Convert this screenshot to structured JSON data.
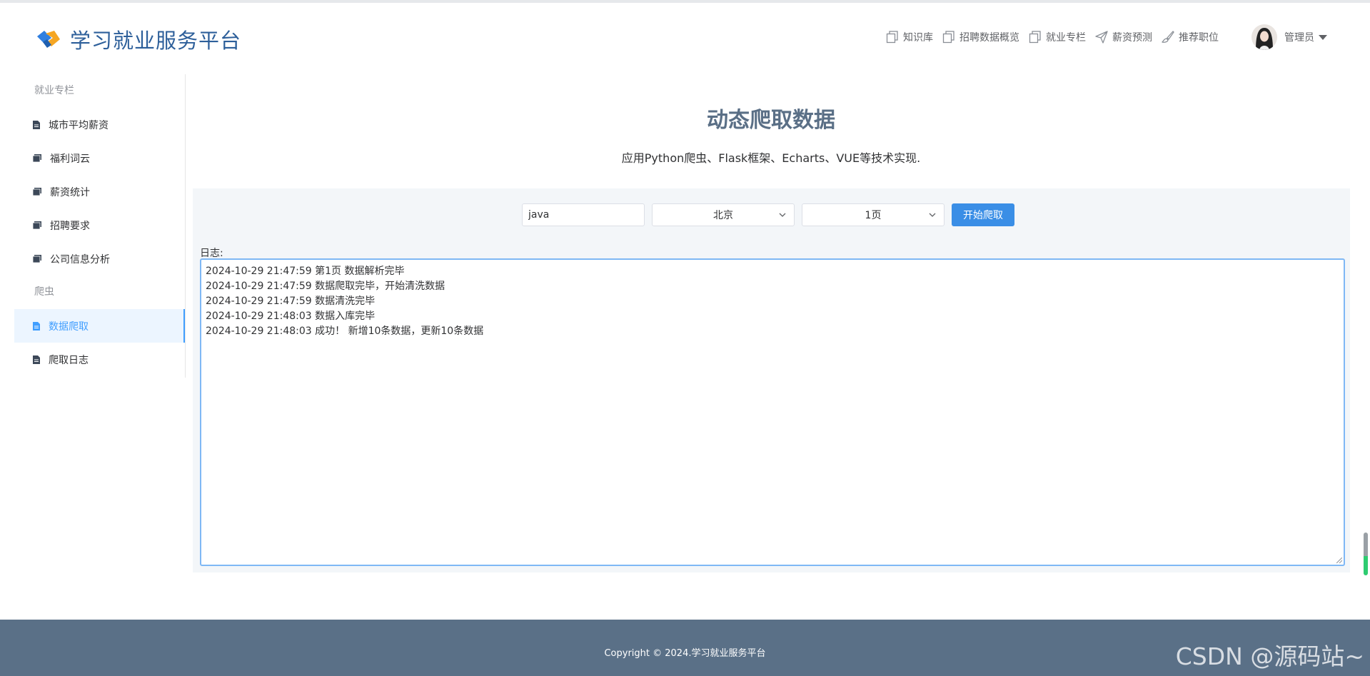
{
  "header": {
    "app_title": "学习就业服务平台",
    "nav": [
      {
        "label": "知识库",
        "icon": "copy-icon"
      },
      {
        "label": "招聘数据概览",
        "icon": "copy-icon"
      },
      {
        "label": "就业专栏",
        "icon": "copy-icon"
      },
      {
        "label": "薪资预测",
        "icon": "send-icon"
      },
      {
        "label": "推荐职位",
        "icon": "brush-icon"
      }
    ],
    "user_name": "管理员"
  },
  "sidebar": {
    "group1": "就业专栏",
    "items1": [
      "城市平均薪资",
      "福利词云",
      "薪资统计",
      "招聘要求",
      "公司信息分析"
    ],
    "group2": "爬虫",
    "items2": [
      "数据爬取",
      "爬取日志"
    ],
    "active": "数据爬取"
  },
  "main": {
    "title": "动态爬取数据",
    "subtitle": "应用Python爬虫、Flask框架、Echarts、VUE等技术实现.",
    "keyword_value": "java",
    "city_value": "北京",
    "page_value": "1页",
    "start_button": "开始爬取",
    "log_label": "日志:",
    "log_lines": [
      "2024-10-29 21:47:59 第1页 数据解析完毕",
      "2024-10-29 21:47:59 数据爬取完毕，开始清洗数据",
      "2024-10-29 21:47:59 数据清洗完毕",
      "2024-10-29 21:48:03 数据入库完毕",
      "2024-10-29 21:48:03 成功！ 新增10条数据，更新10条数据"
    ]
  },
  "footer": {
    "copyright": "Copyright © 2024.学习就业服务平台",
    "watermark": "CSDN @源码站~"
  },
  "colors": {
    "brand": "#2d5f9a",
    "primary": "#3a8ee6",
    "active_bg": "#ecf5ff",
    "footer_bg": "#5a7087"
  }
}
